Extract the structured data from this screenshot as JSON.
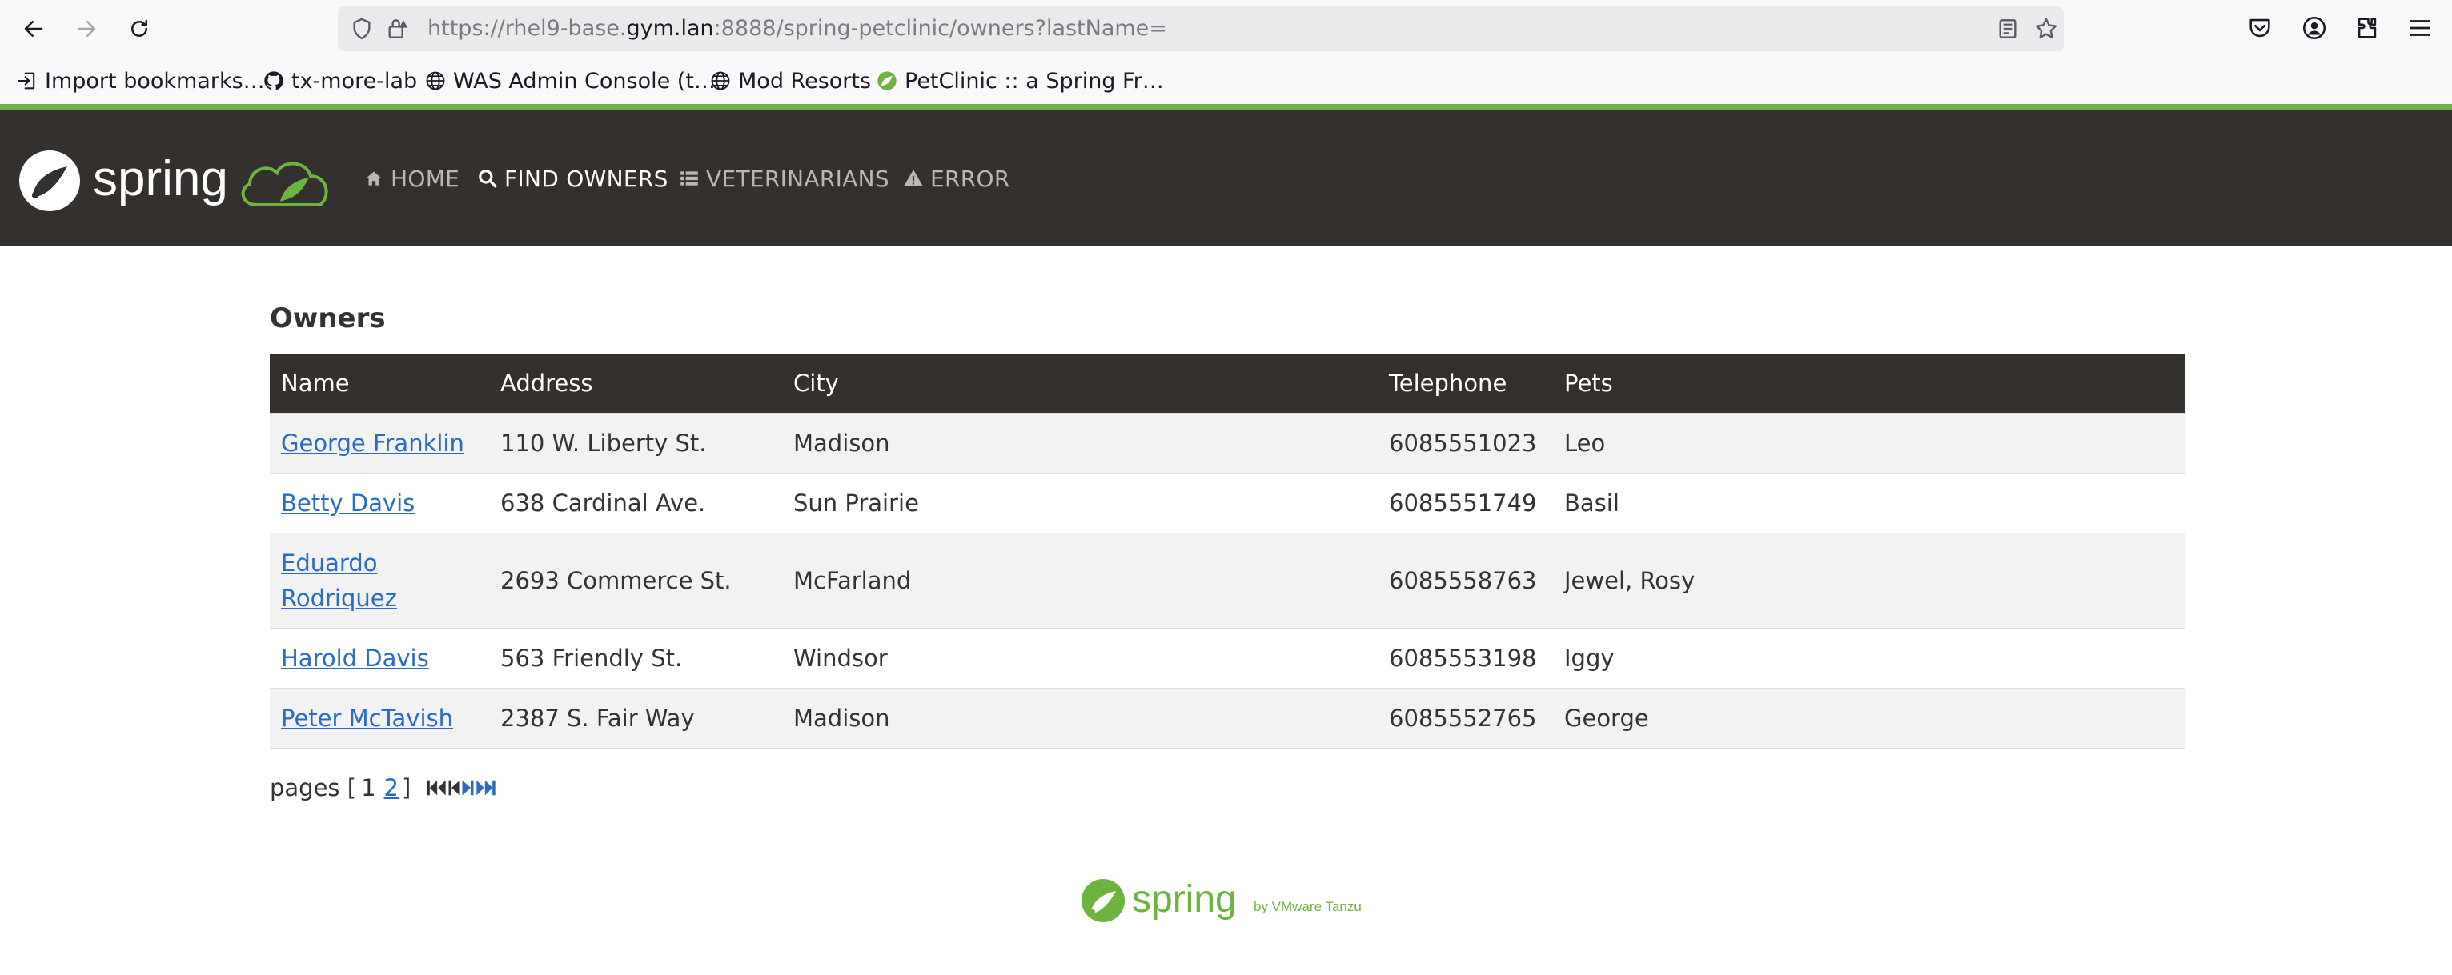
{
  "browser": {
    "url_prefix": "https://rhel9-base.",
    "url_domain": "gym.lan",
    "url_suffix": ":8888/spring-petclinic/owners?lastName=",
    "bookmarks": [
      {
        "label": "Import bookmarks…",
        "icon": "import-icon"
      },
      {
        "label": "tx-more-lab",
        "icon": "github-icon"
      },
      {
        "label": "WAS Admin Console (t…",
        "icon": "globe-icon"
      },
      {
        "label": "Mod Resorts",
        "icon": "globe-icon"
      },
      {
        "label": "PetClinic :: a Spring Fr…",
        "icon": "spring-leaf-icon"
      }
    ]
  },
  "navbar": {
    "brand": "spring",
    "items": [
      {
        "label": "Home",
        "icon": "home-icon",
        "active": false
      },
      {
        "label": "Find owners",
        "icon": "search-icon",
        "active": true
      },
      {
        "label": "Veterinarians",
        "icon": "list-icon",
        "active": false
      },
      {
        "label": "Error",
        "icon": "warning-icon",
        "active": false
      }
    ]
  },
  "main": {
    "title": "Owners",
    "columns": [
      "Name",
      "Address",
      "City",
      "Telephone",
      "Pets"
    ],
    "rows": [
      {
        "name": "George Franklin",
        "address": "110 W. Liberty St.",
        "city": "Madison",
        "telephone": "6085551023",
        "pets": "Leo"
      },
      {
        "name": "Betty Davis",
        "address": "638 Cardinal Ave.",
        "city": "Sun Prairie",
        "telephone": "6085551749",
        "pets": "Basil"
      },
      {
        "name": "Eduardo Rodriquez",
        "name_line1": "Eduardo",
        "name_line2": "Rodriquez",
        "address": "2693 Commerce St.",
        "city": "McFarland",
        "telephone": "6085558763",
        "pets": "Jewel, Rosy"
      },
      {
        "name": "Harold Davis",
        "address": "563 Friendly St.",
        "city": "Windsor",
        "telephone": "6085553198",
        "pets": "Iggy"
      },
      {
        "name": "Peter McTavish",
        "address": "2387 S. Fair Way",
        "city": "Madison",
        "telephone": "6085552765",
        "pets": "George"
      }
    ],
    "pager": {
      "prefix": "pages [",
      "current": "1",
      "next": "2",
      "suffix": "]"
    }
  },
  "footer": {
    "brand": "spring",
    "tagline": "by VMware Tanzu"
  },
  "colors": {
    "spring_green": "#6db33f",
    "navbar_bg": "#34302d",
    "link_blue": "#2a6ac8"
  }
}
